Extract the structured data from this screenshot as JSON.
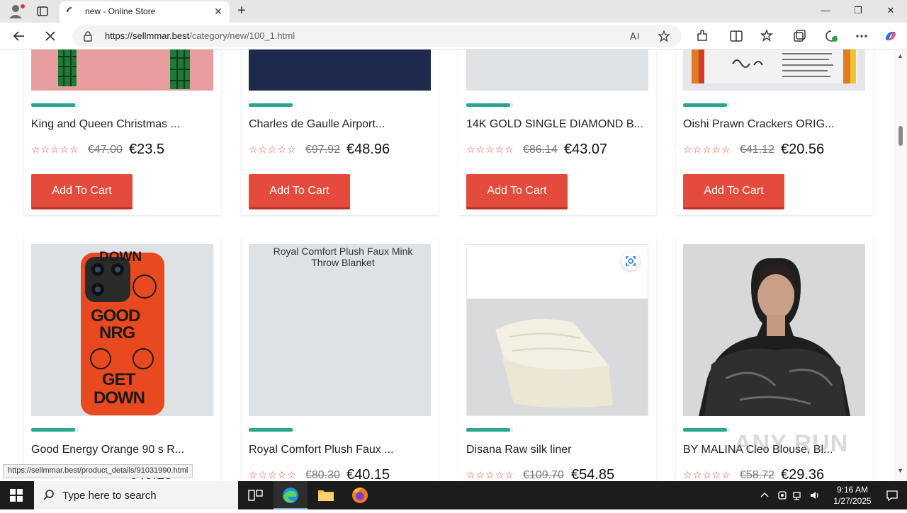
{
  "browser": {
    "tab_title": "new - Online Store",
    "url_host": "https://sellmmar.best",
    "url_path": "/category/new/100_1.html",
    "window_controls": [
      "minimize",
      "restore",
      "close"
    ]
  },
  "products_row1": [
    {
      "name": "King and Queen Christmas ...",
      "old_price": "€47.00",
      "price": "€23.5",
      "cta": "Add To Cart"
    },
    {
      "name": "Charles de Gaulle Airport...",
      "old_price": "€97.92",
      "price": "€48.96",
      "cta": "Add To Cart"
    },
    {
      "name": "14K GOLD SINGLE DIAMOND B...",
      "old_price": "€86.14",
      "price": "€43.07",
      "cta": "Add To Cart"
    },
    {
      "name": "Oishi Prawn Crackers ORIG...",
      "old_price": "€41.12",
      "price": "€20.56",
      "cta": "Add To Cart"
    }
  ],
  "products_row2": [
    {
      "name": "Good Energy Orange 90 s R...",
      "old_price": "€80.30",
      "price": "€40.15",
      "image_alt": "",
      "phone_text_1": "GOOD",
      "phone_text_2": "NRG",
      "phone_text_3": "GET",
      "phone_text_4": "DOWN",
      "phone_text_top": "DOWN"
    },
    {
      "name": "Royal Comfort Plush Faux ...",
      "old_price": "€80.30",
      "price": "€40.15",
      "image_alt": "Royal Comfort Plush Faux Mink Throw Blanket"
    },
    {
      "name": "Disana Raw silk liner",
      "old_price": "€109.70",
      "price": "€54.85",
      "image_alt": ""
    },
    {
      "name": "BY MALINA Cleo Blouse, Bl...",
      "old_price": "€58.72",
      "price": "€29.36",
      "image_alt": ""
    }
  ],
  "rating_stars": "☆☆☆☆☆",
  "status_url": "https://sellmmar.best/product_details/91031990.html",
  "taskbar": {
    "search_placeholder": "Type here to search",
    "time": "9:16 AM",
    "date": "1/27/2025"
  },
  "watermark": "ANY RUN",
  "colors": {
    "accent_red": "#e44b3c",
    "rating_bar": "#2ca58d"
  }
}
